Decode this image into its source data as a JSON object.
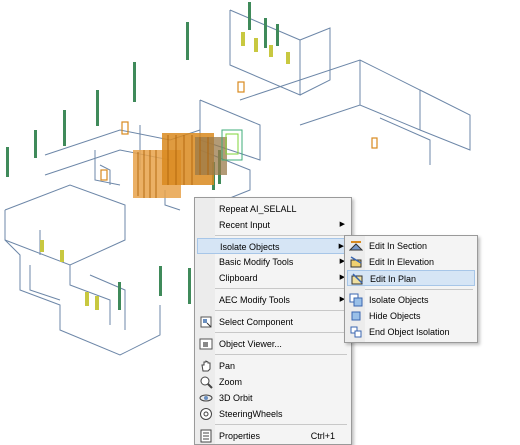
{
  "context_menu": {
    "items": [
      {
        "label": "Repeat AI_SELALL",
        "icon": "",
        "submenu": false
      },
      {
        "label": "Recent Input",
        "icon": "",
        "submenu": true
      },
      {
        "label": "Isolate Objects",
        "icon": "",
        "submenu": true
      },
      {
        "label": "Basic Modify Tools",
        "icon": "",
        "submenu": true
      },
      {
        "label": "Clipboard",
        "icon": "",
        "submenu": true
      },
      {
        "label": "AEC Modify Tools",
        "icon": "",
        "submenu": true
      },
      {
        "label": "Select Component",
        "icon": "select-component-icon",
        "submenu": false
      },
      {
        "label": "Object Viewer...",
        "icon": "object-viewer-icon",
        "submenu": false
      },
      {
        "label": "Pan",
        "icon": "pan-hand-icon",
        "submenu": false
      },
      {
        "label": "Zoom",
        "icon": "zoom-icon",
        "submenu": false
      },
      {
        "label": "3D Orbit",
        "icon": "orbit-icon",
        "submenu": false
      },
      {
        "label": "SteeringWheels",
        "icon": "steering-wheel-icon",
        "submenu": false
      },
      {
        "label": "Properties",
        "icon": "properties-icon",
        "submenu": false,
        "shortcut": "Ctrl+1"
      }
    ]
  },
  "submenu": {
    "items": [
      {
        "label": "Edit In Section",
        "icon": "edit-section-icon"
      },
      {
        "label": "Edit In Elevation",
        "icon": "edit-elevation-icon"
      },
      {
        "label": "Edit In Plan",
        "icon": "edit-plan-icon"
      },
      {
        "label": "Isolate Objects",
        "icon": "isolate-objects-icon"
      },
      {
        "label": "Hide Objects",
        "icon": "hide-objects-icon"
      },
      {
        "label": "End Object Isolation",
        "icon": "end-isolation-icon"
      }
    ]
  },
  "colors": {
    "wall_line": "#6d87a8",
    "column_green": "#3f8a5a",
    "furniture_orange": "#d98a1e",
    "window_yellow": "#c8c840",
    "menu_highlight": "#d6e5f5"
  },
  "submenu_arrow": "▶"
}
